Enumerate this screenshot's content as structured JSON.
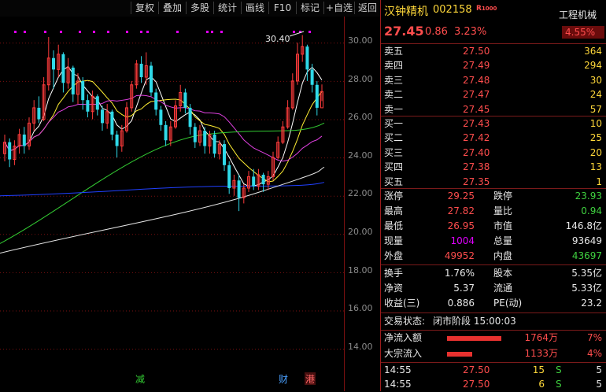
{
  "toolbar": {
    "fuquan": "复权",
    "diejia": "叠加",
    "duogu": "多股",
    "tongji": "统计",
    "huaxian": "画线",
    "f10": "F10",
    "biaoji": "标记",
    "zixuan": "+自选",
    "fanhui": "返回"
  },
  "chart": {
    "y_ticks": [
      "30.00",
      "28.00",
      "26.00",
      "24.00",
      "22.00",
      "20.00",
      "18.00",
      "16.00",
      "14.00"
    ],
    "high_label": "30.40",
    "markers": {
      "jian": "减",
      "cai": "财",
      "gang": "港"
    },
    "colors": {
      "up": "#ff3b3b",
      "down": "#2fd9e8",
      "ma5": "#ffffff",
      "ma10": "#ffee33",
      "ma20": "#e040e0",
      "ma30": "#33cc33",
      "ma60": "#2040ff",
      "ma120": "#e8e8e8"
    }
  },
  "quote": {
    "name": "汉钟精机",
    "code": "002158",
    "badge": "R",
    "sector": "工程机械",
    "sector_change": "4.55%",
    "price": "27.45",
    "change": "0.86",
    "change_pct": "3.23%"
  },
  "order_book": {
    "sell": [
      {
        "label": "卖五",
        "price": "27.50",
        "vol": "364"
      },
      {
        "label": "卖四",
        "price": "27.49",
        "vol": "294"
      },
      {
        "label": "卖三",
        "price": "27.48",
        "vol": "30"
      },
      {
        "label": "卖二",
        "price": "27.47",
        "vol": "24"
      },
      {
        "label": "卖一",
        "price": "27.45",
        "vol": "57"
      }
    ],
    "buy": [
      {
        "label": "买一",
        "price": "27.43",
        "vol": "10"
      },
      {
        "label": "买二",
        "price": "27.42",
        "vol": "25"
      },
      {
        "label": "买三",
        "price": "27.40",
        "vol": "20"
      },
      {
        "label": "买四",
        "price": "27.38",
        "vol": "13"
      },
      {
        "label": "买五",
        "price": "27.35",
        "vol": "1"
      }
    ]
  },
  "stats": {
    "zhangting_label": "涨停",
    "zhangting": "29.25",
    "dieting_label": "跌停",
    "dieting": "23.93",
    "zuigao_label": "最高",
    "zuigao": "27.82",
    "liangbi_label": "量比",
    "liangbi": "0.94",
    "zuidi_label": "最低",
    "zuidi": "26.95",
    "shizhi_label": "市值",
    "shizhi": "146.8亿",
    "xianliang_label": "现量",
    "xianliang": "1004",
    "zongliang_label": "总量",
    "zongliang": "93649",
    "waipan_label": "外盘",
    "waipan": "49952",
    "neipan_label": "内盘",
    "neipan": "43697"
  },
  "fund": {
    "huanshou_label": "换手",
    "huanshou": "1.76%",
    "guben_label": "股本",
    "guben": "5.35亿",
    "jingzi_label": "净资",
    "jingzi": "5.37",
    "liutong_label": "流通",
    "liutong": "5.33亿",
    "shouyi_label": "收益(三)",
    "shouyi": "0.886",
    "pe_label": "PE(动)",
    "pe": "23.2"
  },
  "status": {
    "label": "交易状态:",
    "value": "闭市阶段 15:00:03"
  },
  "flows": [
    {
      "label": "净流入额",
      "amount": "1764万",
      "pct": "7%",
      "bar": 0.55
    },
    {
      "label": "大宗流入",
      "amount": "1133万",
      "pct": "4%",
      "bar": 0.25
    }
  ],
  "ticks": [
    {
      "time": "14:55",
      "price": "27.50",
      "vol": "15",
      "side": "S",
      "num": "5"
    },
    {
      "time": "14:55",
      "price": "27.50",
      "vol": "6",
      "side": "S",
      "num": "5"
    }
  ]
}
